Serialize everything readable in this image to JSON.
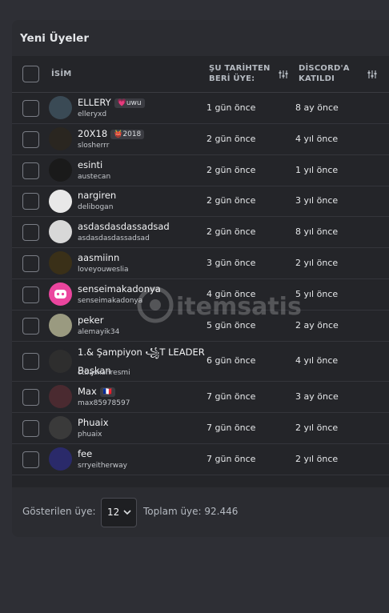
{
  "panel": {
    "title": "Yeni Üyeler"
  },
  "table": {
    "headers": {
      "name": "İSİM",
      "member_since": "ŞU TARİHTEN BERİ ÜYE:",
      "discord_joined": "DİSCORD'A KATILDI"
    },
    "rows": [
      {
        "name": "ELLERY",
        "badge": "💗uwu",
        "handle": "elleryxd",
        "member_since": "1 gün önce",
        "discord_joined": "8 ay önce",
        "avatar_color": "#3a4a55"
      },
      {
        "name": "20X18",
        "badge": "👹2018",
        "handle": "slosherrr",
        "member_since": "2 gün önce",
        "discord_joined": "4 yıl önce",
        "avatar_color": "#2a2620"
      },
      {
        "name": "esinti",
        "badge": "",
        "handle": "austecan",
        "member_since": "2 gün önce",
        "discord_joined": "1 yıl önce",
        "avatar_color": "#1a1a1a"
      },
      {
        "name": "nargiren",
        "badge": "",
        "handle": "delibogan",
        "member_since": "2 gün önce",
        "discord_joined": "3 yıl önce",
        "avatar_color": "#e8e8e8"
      },
      {
        "name": "asdasdasdassadsad",
        "badge": "",
        "handle": "asdasdasdassadsad",
        "member_since": "2 gün önce",
        "discord_joined": "8 yıl önce",
        "avatar_color": "#d8d8d8"
      },
      {
        "name": "aasmiinn",
        "badge": "",
        "handle": "loveyouweslia",
        "member_since": "3 gün önce",
        "discord_joined": "2 yıl önce",
        "avatar_color": "#3a3018"
      },
      {
        "name": "senseimakadonya",
        "badge": "",
        "handle": "senseimakadonya",
        "member_since": "4 gün önce",
        "discord_joined": "5 yıl önce",
        "avatar_color": "#eb459e"
      },
      {
        "name": "peker",
        "badge": "",
        "handle": "alemayik34",
        "member_since": "5 gün önce",
        "discord_joined": "2 ay önce",
        "avatar_color": "#9a9a80"
      },
      {
        "name": "1.& Şampiyon ꧁T LEADER",
        "name2": "Başkan",
        "badge": "",
        "handle": "ctbaskanresmi",
        "member_since": "6 gün önce",
        "discord_joined": "4 yıl önce",
        "avatar_color": "#2e2e2e"
      },
      {
        "name": "Max",
        "badge": "🇫🇷",
        "handle": "max85978597",
        "member_since": "7 gün önce",
        "discord_joined": "3 ay önce",
        "avatar_color": "#4a2a30"
      },
      {
        "name": "Phuaix",
        "badge": "",
        "handle": "phuaix",
        "member_since": "7 gün önce",
        "discord_joined": "2 yıl önce",
        "avatar_color": "#3a3a3a"
      },
      {
        "name": "fee",
        "badge": "",
        "handle": "srryeitherway",
        "member_since": "7 gün önce",
        "discord_joined": "2 yıl önce",
        "avatar_color": "#2a2a6a"
      }
    ]
  },
  "footer": {
    "shown_label": "Gösterilen üye:",
    "page_size": "12",
    "total_label": "Toplam üye: 92.446"
  },
  "watermark": {
    "text": "itemsatis"
  },
  "icons": {
    "sort": "sliders-sort-icon",
    "dropdown": "chevron-down-icon"
  }
}
